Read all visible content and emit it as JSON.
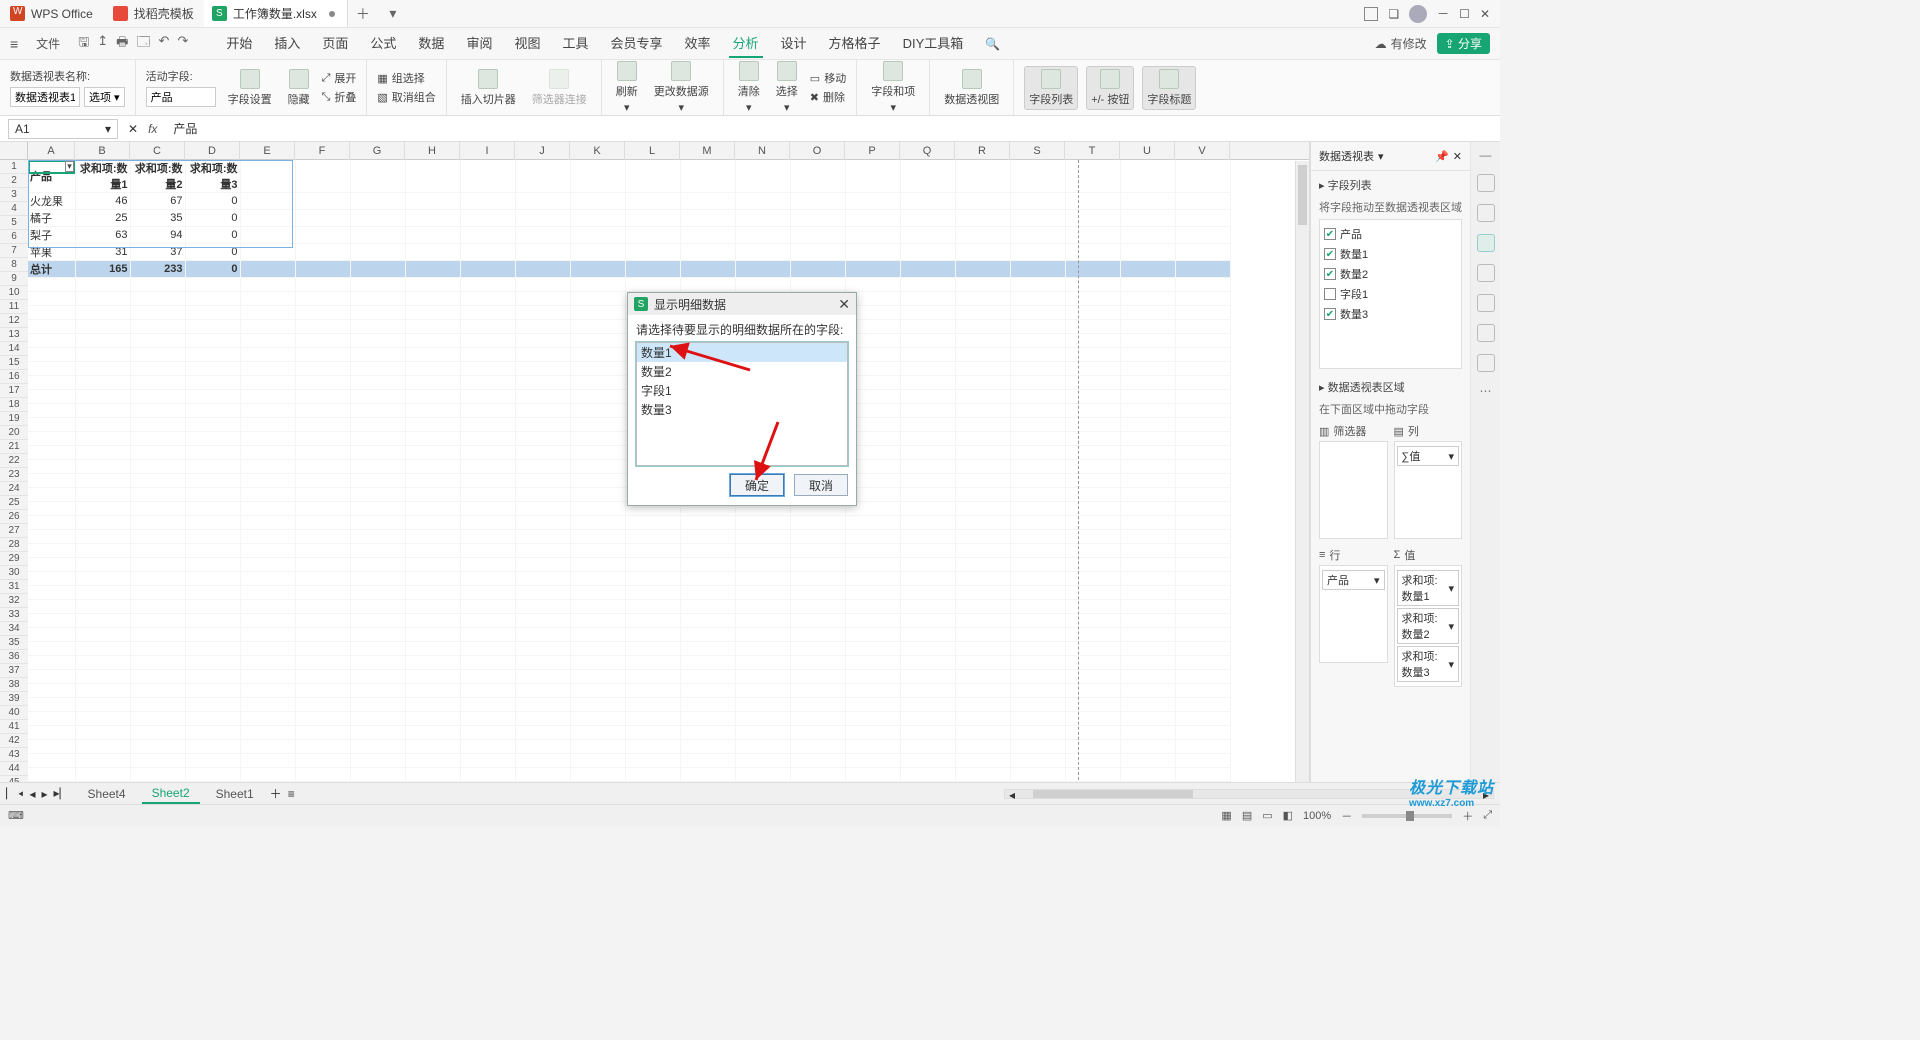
{
  "titlebar": {
    "app": "WPS Office",
    "template_tab": "找稻壳模板",
    "file_tab": "工作簿数量.xlsx"
  },
  "menu": {
    "file": "文件",
    "items": [
      "开始",
      "插入",
      "页面",
      "公式",
      "数据",
      "审阅",
      "视图",
      "工具",
      "会员专享",
      "效率",
      "分析",
      "设计",
      "方格格子",
      "DIY工具箱"
    ],
    "active_index": 10,
    "has_mod": "有修改",
    "share": "分享"
  },
  "ribbon": {
    "name_label": "数据透视表名称:",
    "name_value": "数据透视表1",
    "option_btn": "选项",
    "active_field_label": "活动字段:",
    "active_field_value": "产品",
    "field_setting": "字段设置",
    "hide": "隐藏",
    "expand": "展开",
    "collapse": "折叠",
    "group_select": "组选择",
    "ungroup": "取消组合",
    "insert_slicer": "插入切片器",
    "filter_conn": "筛选器连接",
    "refresh": "刷新",
    "change_source": "更改数据源",
    "clear": "清除",
    "select": "选择",
    "move": "移动",
    "delete": "删除",
    "fields": "字段和项",
    "pivotchart": "数据透视图",
    "fieldlist": "字段列表",
    "pm_button": "+/- 按钮",
    "field_header": "字段标题"
  },
  "formula": {
    "name": "A1",
    "value": "产品"
  },
  "columns": [
    "A",
    "B",
    "C",
    "D",
    "E",
    "F",
    "G",
    "H",
    "I",
    "J",
    "K",
    "L",
    "M",
    "N",
    "O",
    "P",
    "Q",
    "R",
    "S",
    "T",
    "U",
    "V"
  ],
  "rows": 45,
  "sheet": {
    "header": [
      "产品",
      "求和项:数量1",
      "求和项:数量2",
      "求和项:数量3"
    ],
    "data": [
      [
        "火龙果",
        "46",
        "67",
        "0"
      ],
      [
        "橘子",
        "25",
        "35",
        "0"
      ],
      [
        "梨子",
        "63",
        "94",
        "0"
      ],
      [
        "苹果",
        "31",
        "37",
        "0"
      ]
    ],
    "total": [
      "总计",
      "165",
      "233",
      "0"
    ]
  },
  "dialog": {
    "title": "显示明细数据",
    "prompt": "请选择待要显示的明细数据所在的字段:",
    "items": [
      "数量1",
      "数量2",
      "字段1",
      "数量3"
    ],
    "selected": 0,
    "ok": "确定",
    "cancel": "取消"
  },
  "pane": {
    "title": "数据透视表",
    "section1": "字段列表",
    "drag_hint": "将字段拖动至数据透视表区域",
    "fields": [
      {
        "label": "产品",
        "checked": true
      },
      {
        "label": "数量1",
        "checked": true
      },
      {
        "label": "数量2",
        "checked": true
      },
      {
        "label": "字段1",
        "checked": false
      },
      {
        "label": "数量3",
        "checked": true
      }
    ],
    "section2": "数据透视表区域",
    "hint2": "在下面区域中拖动字段",
    "areas": {
      "filter": "筛选器",
      "column": "列",
      "row": "行",
      "values": "值"
    },
    "column_items": [
      "∑值"
    ],
    "row_items": [
      "产品"
    ],
    "value_items": [
      "求和项:数量1",
      "求和项:数量2",
      "求和项:数量3"
    ]
  },
  "sheet_tabs": {
    "left": "Sheet4",
    "active": "Sheet2",
    "right": "Sheet1"
  },
  "status": {
    "zoom": "100%"
  },
  "watermark": {
    "brand": "极光下载站",
    "url": "www.xz7.com"
  }
}
